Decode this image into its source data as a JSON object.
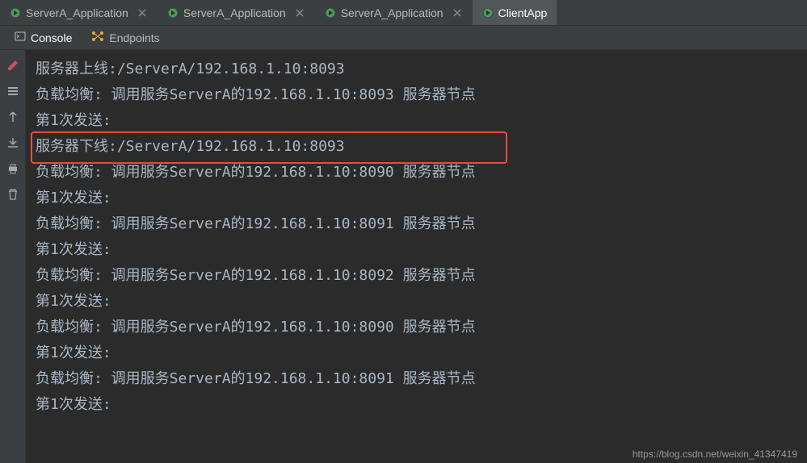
{
  "tabs": [
    {
      "label": "ServerA_Application"
    },
    {
      "label": "ServerA_Application"
    },
    {
      "label": "ServerA_Application"
    },
    {
      "label": "ClientApp"
    }
  ],
  "toolbar": {
    "console": "Console",
    "endpoints": "Endpoints"
  },
  "console": {
    "lines": [
      "服务器上线:/ServerA/192.168.1.10:8093",
      "负载均衡: 调用服务ServerA的192.168.1.10:8093 服务器节点",
      "第1次发送:",
      "服务器下线:/ServerA/192.168.1.10:8093",
      "负载均衡: 调用服务ServerA的192.168.1.10:8090 服务器节点",
      "第1次发送:",
      "负载均衡: 调用服务ServerA的192.168.1.10:8091 服务器节点",
      "第1次发送:",
      "负载均衡: 调用服务ServerA的192.168.1.10:8092 服务器节点",
      "第1次发送:",
      "负载均衡: 调用服务ServerA的192.168.1.10:8090 服务器节点",
      "第1次发送:",
      "负载均衡: 调用服务ServerA的192.168.1.10:8091 服务器节点",
      "第1次发送:"
    ]
  },
  "watermark": "https://blog.csdn.net/weixin_41347419",
  "highlight": {
    "line_index": 3
  }
}
